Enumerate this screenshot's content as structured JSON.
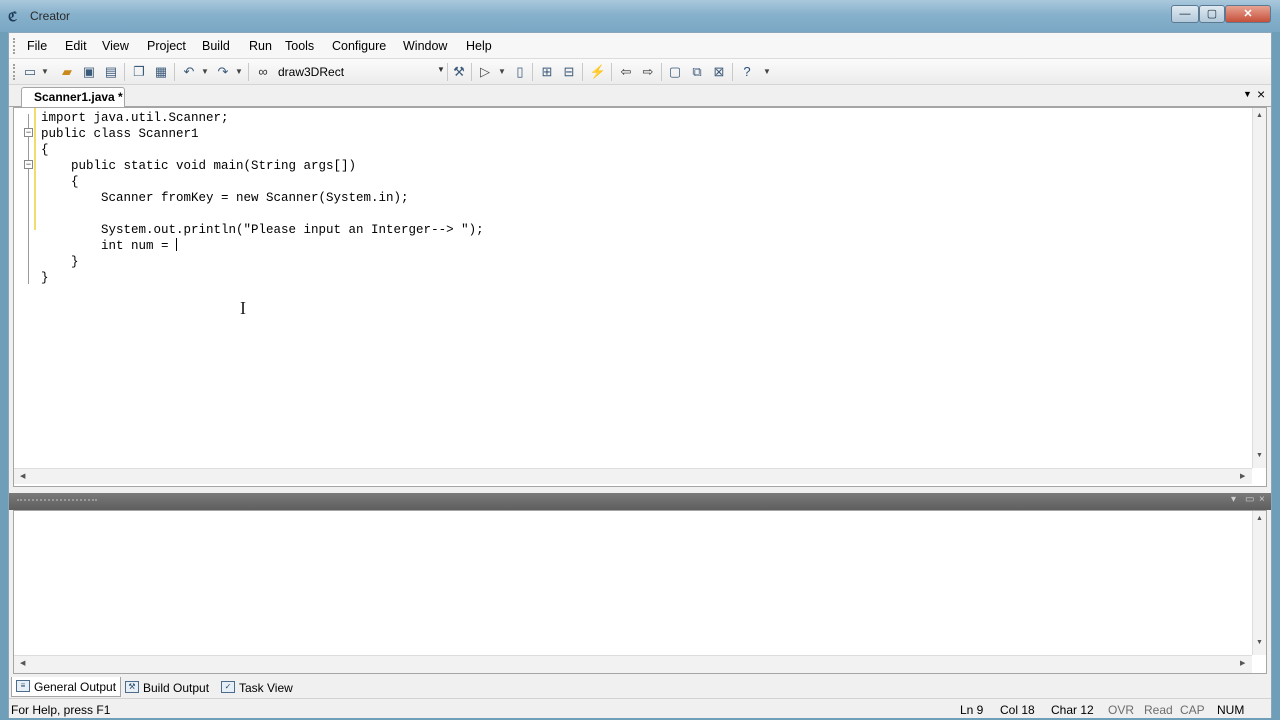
{
  "window": {
    "title": "Creator",
    "minimize": "—",
    "maximize": "▢",
    "close": "✕"
  },
  "menu": [
    "File",
    "Edit",
    "View",
    "Project",
    "Build",
    "Run",
    "Tools",
    "Configure",
    "Window",
    "Help"
  ],
  "toolbar": {
    "run_config": "draw3DRect",
    "icons": [
      "new-file-icon",
      "open-folder-icon",
      "save-icon",
      "save-all-icon",
      "copy-icon",
      "paste-icon",
      "undo-icon",
      "redo-icon",
      "binoculars-icon",
      "build-icon",
      "run-icon",
      "compile-icon",
      "step-into-icon",
      "step-out-icon",
      "wand-icon",
      "back-arrow-icon",
      "forward-arrow-icon",
      "window-icon",
      "bookmark-icon",
      "clear-icon",
      "help-icon"
    ]
  },
  "editor": {
    "tab_label": "Scanner1.java *",
    "code": [
      "import java.util.Scanner;",
      "public class Scanner1",
      "{",
      "    public static void main(String args[])",
      "    {",
      "        Scanner fromKey = new Scanner(System.in);",
      "",
      "        System.out.println(\"Please input an Interger--> \");",
      "        int num = "
    ],
    "code_tail": [
      "    }",
      "}"
    ]
  },
  "output_tabs": [
    "General Output",
    "Build Output",
    "Task View"
  ],
  "status": {
    "help": "For Help, press F1",
    "line": "Ln 9",
    "col": "Col 18",
    "char": "Char 12",
    "ovr": "OVR",
    "read": "Read",
    "cap": "CAP",
    "num": "NUM"
  }
}
